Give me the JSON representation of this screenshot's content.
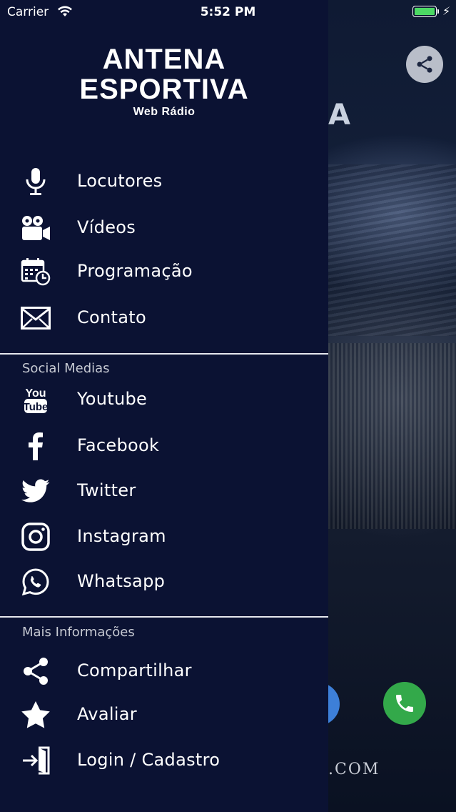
{
  "status_bar": {
    "carrier": "Carrier",
    "time": "5:52 PM"
  },
  "logo": {
    "line1": "ANTENA",
    "line2": "ESPORTIVA",
    "line3": "Web Rádio"
  },
  "background": {
    "logo_fragment": "A",
    "url_fragment": ".COM"
  },
  "menu": [
    {
      "label": "Locutores",
      "icon": "microphone-icon"
    },
    {
      "label": "Vídeos",
      "icon": "video-camera-icon"
    },
    {
      "label": "Programação",
      "icon": "calendar-clock-icon"
    },
    {
      "label": "Contato",
      "icon": "envelope-icon"
    }
  ],
  "social": {
    "title": "Social Medias",
    "items": [
      {
        "label": "Youtube",
        "icon": "youtube-icon"
      },
      {
        "label": "Facebook",
        "icon": "facebook-icon"
      },
      {
        "label": "Twitter",
        "icon": "twitter-icon"
      },
      {
        "label": "Instagram",
        "icon": "instagram-icon"
      },
      {
        "label": "Whatsapp",
        "icon": "whatsapp-icon"
      }
    ]
  },
  "more": {
    "title": "Mais Informações",
    "items": [
      {
        "label": "Compartilhar",
        "icon": "share-icon"
      },
      {
        "label": "Avaliar",
        "icon": "star-icon"
      },
      {
        "label": "Login / Cadastro",
        "icon": "login-icon"
      }
    ]
  },
  "colors": {
    "drawer_bg": "#0b1233",
    "text": "#ffffff",
    "battery": "#4cd964",
    "whatsapp": "#33a94a"
  }
}
